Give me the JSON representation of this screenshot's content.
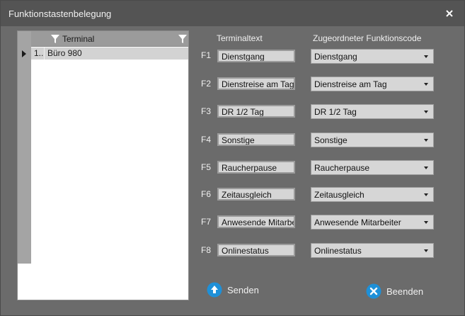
{
  "window": {
    "title": "Funktionstastenbelegung",
    "close_label": "×"
  },
  "grid": {
    "column_header": "Terminal",
    "rows": [
      {
        "num": "1..",
        "value": "Büro 980"
      }
    ]
  },
  "labels": {
    "terminal_text": "Terminaltext",
    "function_code": "Zugeordneter Funktionscode"
  },
  "keys": [
    {
      "key": "F1",
      "text": "Dienstgang",
      "code": "Dienstgang"
    },
    {
      "key": "F2",
      "text": "Dienstreise am Tag",
      "code": "Dienstreise am Tag"
    },
    {
      "key": "F3",
      "text": "DR 1/2 Tag",
      "code": "DR 1/2 Tag"
    },
    {
      "key": "F4",
      "text": "Sonstige",
      "code": "Sonstige"
    },
    {
      "key": "F5",
      "text": "Raucherpause",
      "code": "Raucherpause"
    },
    {
      "key": "F6",
      "text": "Zeitausgleich",
      "code": "Zeitausgleich"
    },
    {
      "key": "F7",
      "text": "Anwesende Mitarbeiter",
      "code": "Anwesende Mitarbeiter"
    },
    {
      "key": "F8",
      "text": "Onlinestatus",
      "code": "Onlinestatus"
    }
  ],
  "buttons": {
    "send": "Senden",
    "exit": "Beenden"
  },
  "colors": {
    "accent": "#1e90d8",
    "background": "#6b6b6b",
    "titlebar": "#545454"
  }
}
